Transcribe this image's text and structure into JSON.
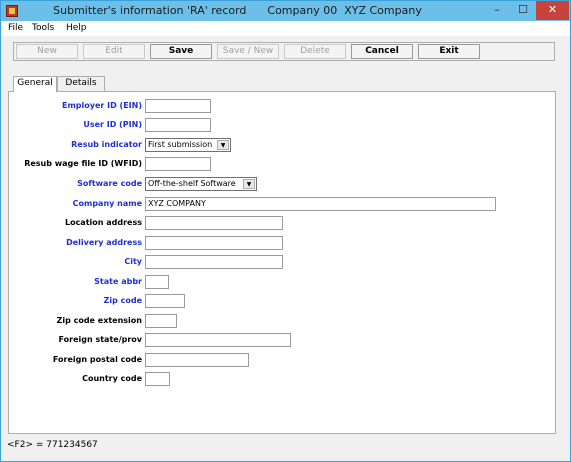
{
  "window": {
    "title": "Submitter's information 'RA' record      Company 00  XYZ Company",
    "minimize_glyph": "–",
    "maximize_glyph": "☐",
    "close_glyph": "✕"
  },
  "menu": {
    "file": "File",
    "tools": "Tools",
    "help": "Help"
  },
  "toolbar": {
    "new": "New",
    "edit": "Edit",
    "save": "Save",
    "save_new": "Save / New",
    "delete": "Delete",
    "cancel": "Cancel",
    "exit": "Exit"
  },
  "tabs": {
    "general": "General",
    "details": "Details"
  },
  "form": {
    "employer_id_label": "Employer ID (EIN)",
    "employer_id_value": "",
    "user_id_label": "User ID (PIN)",
    "user_id_value": "",
    "resub_indicator_label": "Resub indicator",
    "resub_indicator_value": "First submission",
    "resub_wfid_label": "Resub wage file ID (WFID)",
    "resub_wfid_value": "",
    "software_code_label": "Software code",
    "software_code_value": "Off-the-shelf Software",
    "company_name_label": "Company name",
    "company_name_value": "XYZ COMPANY",
    "location_address_label": "Location address",
    "location_address_value": "",
    "delivery_address_label": "Delivery address",
    "delivery_address_value": "",
    "city_label": "City",
    "city_value": "",
    "state_abbr_label": "State abbr",
    "state_abbr_value": "",
    "zip_code_label": "Zip code",
    "zip_code_value": "",
    "zip_ext_label": "Zip code extension",
    "zip_ext_value": "",
    "foreign_state_label": "Foreign state/prov",
    "foreign_state_value": "",
    "foreign_postal_label": "Foreign postal code",
    "foreign_postal_value": "",
    "country_code_label": "Country code",
    "country_code_value": ""
  },
  "status": {
    "text": "<F2> = 771234567"
  },
  "colors": {
    "required_label": "#1f2fd6",
    "titlebar": "#6cbfe8",
    "close_button": "#c7433b"
  }
}
